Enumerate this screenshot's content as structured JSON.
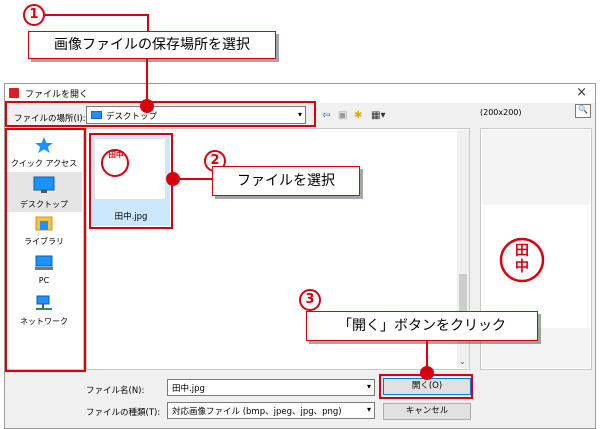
{
  "dialog": {
    "title": "ファイルを開く",
    "close": "×"
  },
  "location": {
    "label": "ファイルの場所(I):",
    "value": "デスクトップ",
    "dropdown_arrow": "▾"
  },
  "toolbar": {
    "back": "⇦",
    "up": "▣",
    "new_folder": "✱",
    "view": "▦▾"
  },
  "places": [
    {
      "label": "クイック アクセス",
      "icon": "star-icon"
    },
    {
      "label": "デスクトップ",
      "icon": "desktop-icon"
    },
    {
      "label": "ライブラリ",
      "icon": "library-icon"
    },
    {
      "label": "PC",
      "icon": "pc-icon"
    },
    {
      "label": "ネットワーク",
      "icon": "network-icon"
    }
  ],
  "files": [
    {
      "name": "田中.jpg",
      "stamp_text": "田中"
    }
  ],
  "preview": {
    "size_label": "(200x200)",
    "stamp_text": "田中",
    "button_label": "🔍"
  },
  "scroll": {
    "down_arrow": "⌄"
  },
  "filename": {
    "label": "ファイル名(N):",
    "value": "田中.jpg"
  },
  "filetype": {
    "label": "ファイルの種類(T):",
    "value": "対応画像ファイル (bmp、jpeg、jpg、png)"
  },
  "buttons": {
    "open": "開く(O)",
    "cancel": "キャンセル"
  },
  "annotations": [
    {
      "number": "1",
      "text": "画像ファイルの保存場所を選択"
    },
    {
      "number": "2",
      "text": "ファイルを選択"
    },
    {
      "number": "3",
      "text": "「開く」ボタンをクリック"
    }
  ],
  "colors": {
    "accent_red": "#d7000f",
    "selection": "#cce8ff",
    "stamp_red": "#d7000f"
  }
}
